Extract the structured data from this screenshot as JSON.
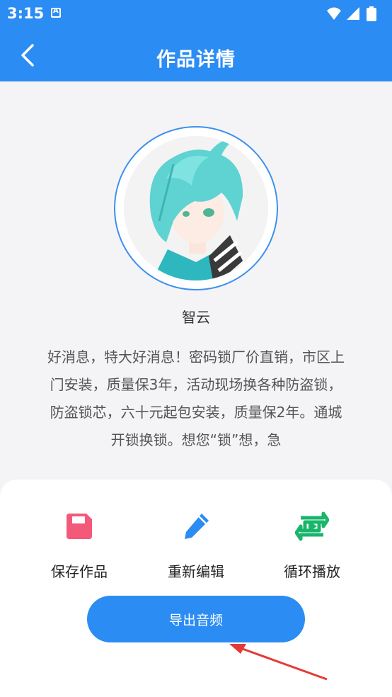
{
  "status_bar": {
    "time": "3:15",
    "icons": [
      "a-notification-icon",
      "wifi-icon",
      "signal-icon",
      "battery-icon"
    ]
  },
  "app_bar": {
    "title": "作品详情",
    "back_icon": "chevron-left-icon"
  },
  "work": {
    "author": "智云",
    "text": "好消息，特大好消息！密码锁厂价直销，市区上门安装，质量保3年，活动现场换各种防盗锁，防盗锁芯，六十元起包安装，质量保2年。通城开锁换锁。想您“锁”想，急"
  },
  "actions": [
    {
      "label": "保存作品",
      "icon": "save-icon",
      "color": "#f35a7a"
    },
    {
      "label": "重新编辑",
      "icon": "pencil-icon",
      "color": "#2b8cf3"
    },
    {
      "label": "循环播放",
      "icon": "loop-play-icon",
      "color": "#19b56a"
    }
  ],
  "export_button": {
    "label": "导出音频"
  },
  "colors": {
    "primary": "#2b8cf3",
    "background": "#f4f4f6",
    "annotation_arrow": "#e53935"
  }
}
